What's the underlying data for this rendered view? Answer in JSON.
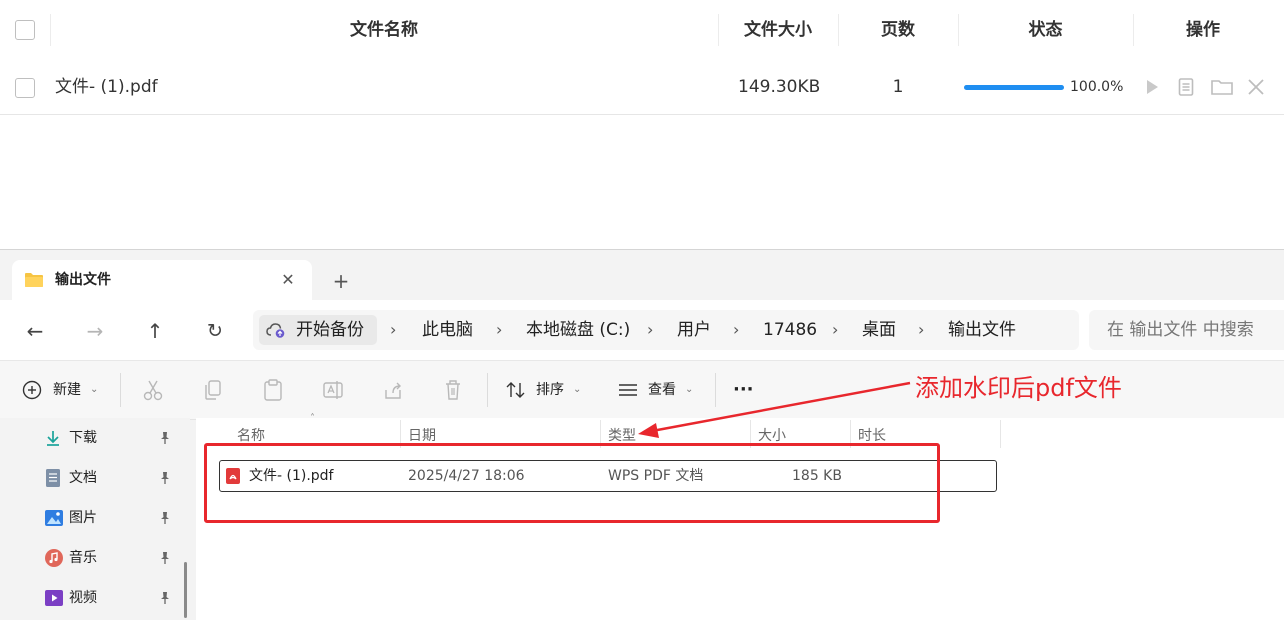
{
  "table": {
    "headers": {
      "name": "文件名称",
      "size": "文件大小",
      "pages": "页数",
      "status": "状态",
      "actions": "操作"
    },
    "rows": [
      {
        "name": "文件- (1).pdf",
        "size": "149.30KB",
        "pages": "1",
        "progress_text": "100.0%",
        "progress_fraction": 1.0
      }
    ]
  },
  "explorer": {
    "tab_title": "输出文件",
    "breadcrumb": [
      "开始备份",
      "此电脑",
      "本地磁盘 (C:)",
      "用户",
      "17486",
      "桌面",
      "输出文件"
    ],
    "search_placeholder": "在 输出文件 中搜索",
    "toolbar": {
      "new_label": "新建",
      "sort_label": "排序",
      "view_label": "查看",
      "more_label": "···"
    },
    "sidebar": [
      {
        "label": "下载",
        "icon": "download-icon"
      },
      {
        "label": "文档",
        "icon": "document-icon"
      },
      {
        "label": "图片",
        "icon": "pictures-icon"
      },
      {
        "label": "音乐",
        "icon": "music-icon"
      },
      {
        "label": "视频",
        "icon": "video-icon"
      }
    ],
    "columns": {
      "name": "名称",
      "date": "日期",
      "type": "类型",
      "size": "大小",
      "duration": "时长"
    },
    "files": [
      {
        "name": "文件- (1).pdf",
        "date": "2025/4/27 18:06",
        "type": "WPS PDF 文档",
        "size": "185 KB"
      }
    ]
  },
  "annotation": {
    "text": "添加水印后pdf文件",
    "color": "#e8272d"
  },
  "colors": {
    "accent": "#1f8ef1",
    "annotation_red": "#e8272d"
  }
}
